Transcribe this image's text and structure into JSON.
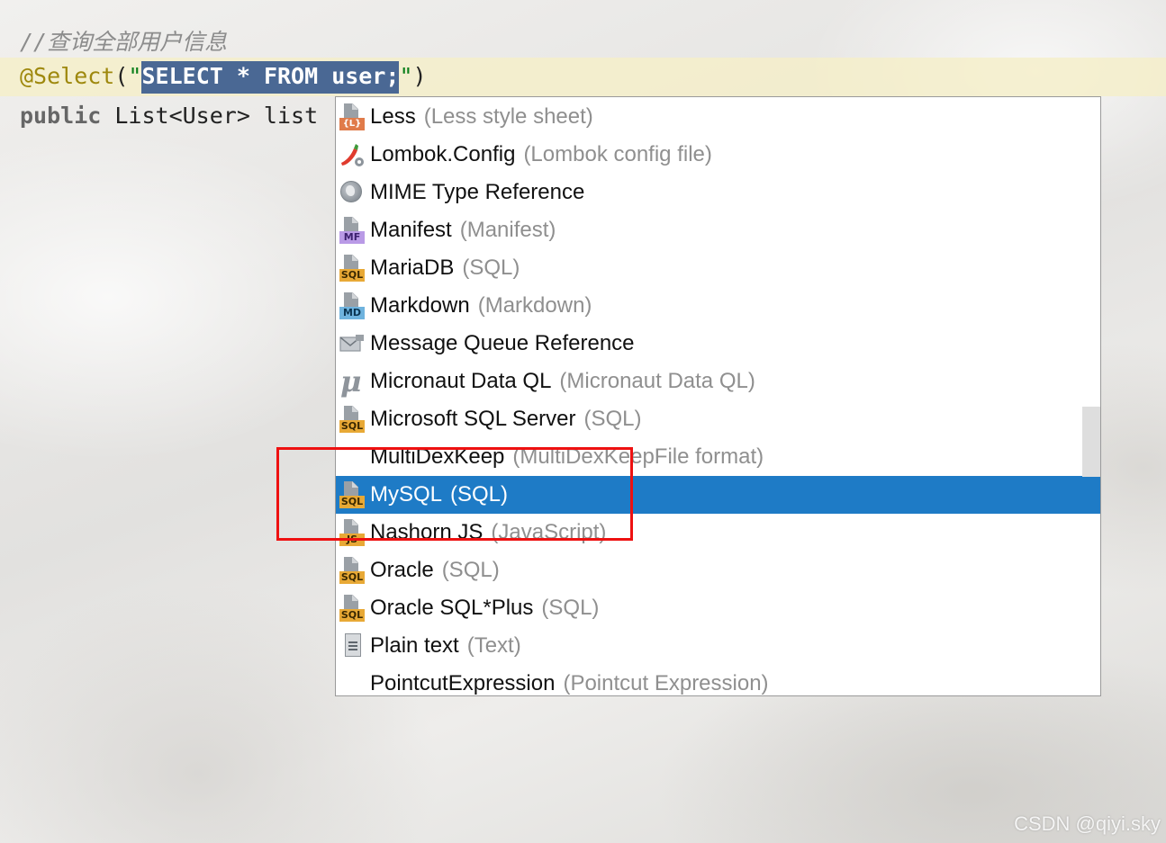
{
  "editor": {
    "comment": "//查询全部用户信息",
    "annotation": "@Select",
    "paren_open": "(",
    "quote_open": "\"",
    "selected_sql": "SELECT * FROM user;",
    "quote_close": "\"",
    "paren_close": ")",
    "method_keyword": "public",
    "method_rest": " List<User> list"
  },
  "popup": {
    "selected_index": 10,
    "items": [
      {
        "label": "Less",
        "hint": "(Less style sheet)",
        "icon": "less-file-icon",
        "tag": "{L}"
      },
      {
        "label": "Lombok.Config",
        "hint": "(Lombok config file)",
        "icon": "lombok-config-icon",
        "tag": ""
      },
      {
        "label": "MIME Type Reference",
        "hint": "",
        "icon": "globe-icon",
        "tag": ""
      },
      {
        "label": "Manifest",
        "hint": "(Manifest)",
        "icon": "manifest-file-icon",
        "tag": "MF"
      },
      {
        "label": "MariaDB",
        "hint": "(SQL)",
        "icon": "sql-file-icon",
        "tag": "SQL"
      },
      {
        "label": "Markdown",
        "hint": "(Markdown)",
        "icon": "markdown-file-icon",
        "tag": "MD"
      },
      {
        "label": "Message Queue Reference",
        "hint": "",
        "icon": "mail-icon",
        "tag": ""
      },
      {
        "label": "Micronaut Data QL",
        "hint": "(Micronaut Data QL)",
        "icon": "micronaut-icon",
        "tag": ""
      },
      {
        "label": "Microsoft SQL Server",
        "hint": "(SQL)",
        "icon": "sql-file-icon",
        "tag": "SQL"
      },
      {
        "label": "MultiDexKeep",
        "hint": "(MultiDexKeepFile format)",
        "icon": "",
        "tag": ""
      },
      {
        "label": "MySQL",
        "hint": "(SQL)",
        "icon": "sql-file-icon",
        "tag": "SQL"
      },
      {
        "label": "Nashorn JS",
        "hint": "(JavaScript)",
        "icon": "js-file-icon",
        "tag": "JS"
      },
      {
        "label": "Oracle",
        "hint": "(SQL)",
        "icon": "sql-file-icon",
        "tag": "SQL"
      },
      {
        "label": "Oracle SQL*Plus",
        "hint": "(SQL)",
        "icon": "sql-file-icon",
        "tag": "SQL"
      },
      {
        "label": "Plain text",
        "hint": "(Text)",
        "icon": "text-file-icon",
        "tag": ""
      },
      {
        "label": "PointcutExpression",
        "hint": "(Pointcut Expression)",
        "icon": "",
        "tag": ""
      }
    ]
  },
  "colors": {
    "selection_bg": "#1e7bc6",
    "annotation_box": "#ee1111",
    "code_selection": "#4a6894"
  },
  "watermark": "CSDN @qiyi.sky"
}
